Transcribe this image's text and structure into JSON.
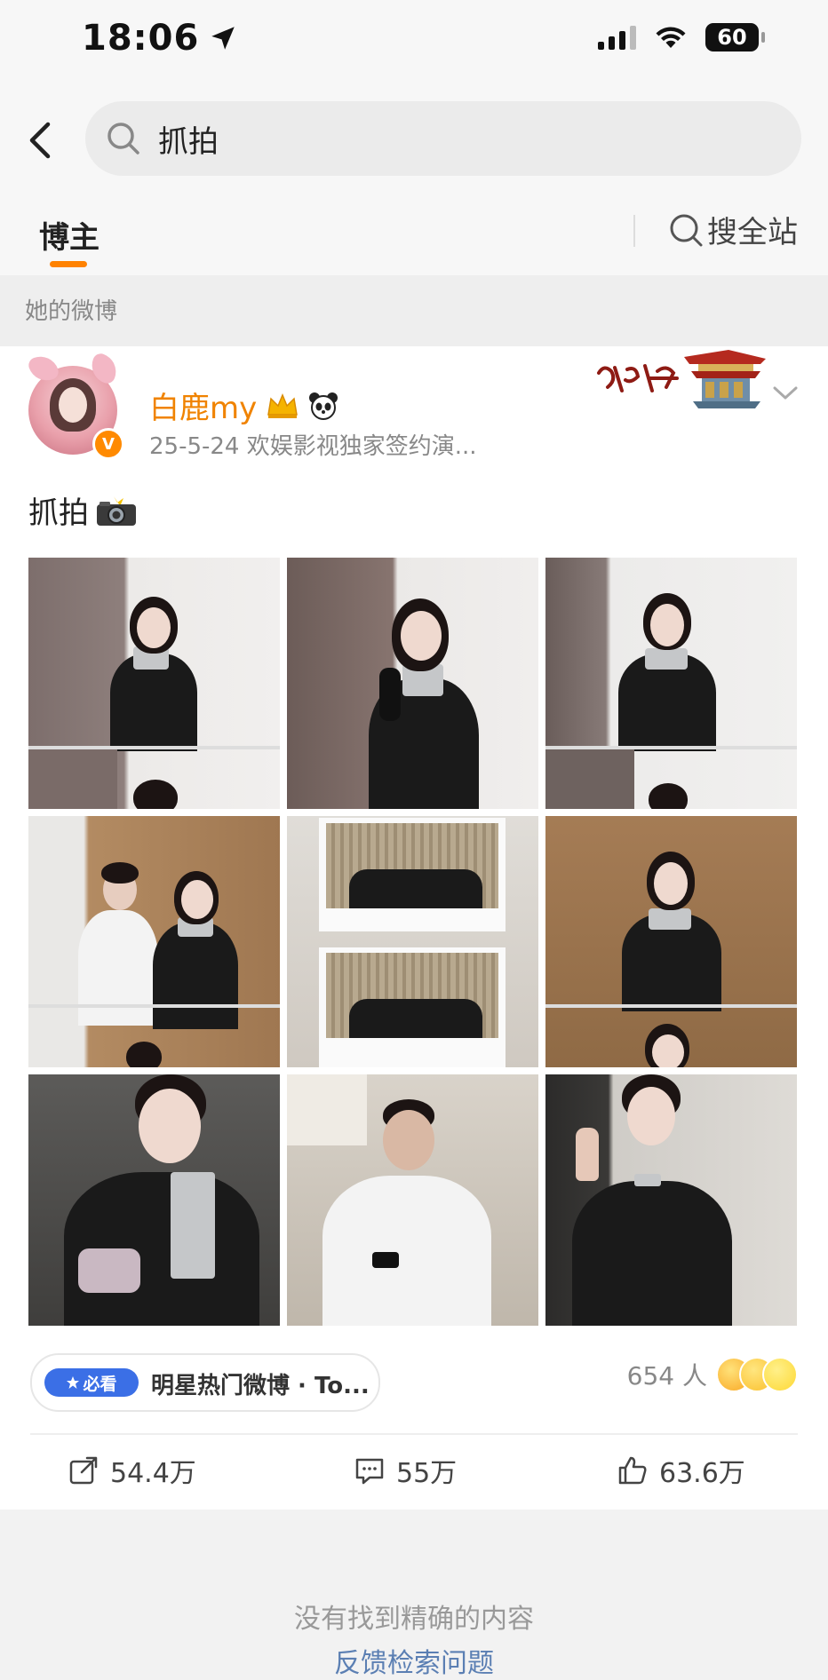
{
  "status": {
    "time": "18:06",
    "battery": "60"
  },
  "search": {
    "query": "抓拍"
  },
  "tabs": {
    "active": "博主",
    "site_search": "搜全站"
  },
  "section": {
    "label": "她的微博"
  },
  "post": {
    "author": "白鹿my",
    "meta": "25-5-24  欢娱影视独家签约演...",
    "text": "抓拍",
    "photo_count": 9,
    "topic_badge": "必看",
    "topic_text": "明星热门微博 · To...",
    "reaction_count": "654 人",
    "repost": "54.4万",
    "comment": "55万",
    "like": "63.6万"
  },
  "footer": {
    "no_result": "没有找到精确的内容",
    "feedback": "反馈检索问题"
  },
  "colors": {
    "accent": "#ff8200",
    "author": "#f08300",
    "badge": "#3b6fe6"
  }
}
